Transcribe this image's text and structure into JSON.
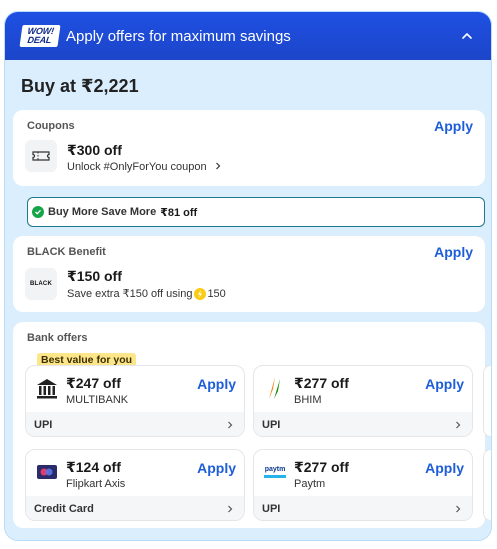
{
  "header": {
    "logo_line1": "WOW!",
    "logo_line2": "DEAL",
    "title": "Apply offers for maximum savings"
  },
  "buy_at": "Buy at ₹2,221",
  "coupons": {
    "label": "Coupons",
    "apply": "Apply",
    "amount": "₹300 off",
    "description": "Unlock #OnlyForYou coupon"
  },
  "buy_more": {
    "text": "Buy More Save More",
    "amount": "₹81 off"
  },
  "black": {
    "label": "BLACK Benefit",
    "apply": "Apply",
    "logo_text": "BLACK",
    "amount": "₹150 off",
    "description": "Save extra ₹150 off using",
    "coins": "150"
  },
  "bank": {
    "label": "Bank offers",
    "best_badge": "Best value for you",
    "offers": [
      {
        "amount": "₹247 off",
        "name": "MULTIBANK",
        "apply": "Apply",
        "method": "UPI",
        "icon": "bank-icon"
      },
      {
        "amount": "₹277 off",
        "name": "BHIM",
        "apply": "Apply",
        "method": "UPI",
        "icon": "bhim-logo"
      },
      {
        "amount": "₹124 off",
        "name": "Flipkart Axis",
        "apply": "Apply",
        "method": "Credit Card",
        "icon": "credit-card-icon"
      },
      {
        "amount": "₹277 off",
        "name": "Paytm",
        "apply": "Apply",
        "method": "UPI",
        "icon": "paytm-logo",
        "logo_text": "paytm"
      }
    ]
  },
  "colors": {
    "header_bg": "#1f50e3",
    "panel_bg": "#dbeefd",
    "apply_blue": "#1d5ed8",
    "badge_yellow": "#fde68a",
    "success_green": "#16a34a"
  }
}
